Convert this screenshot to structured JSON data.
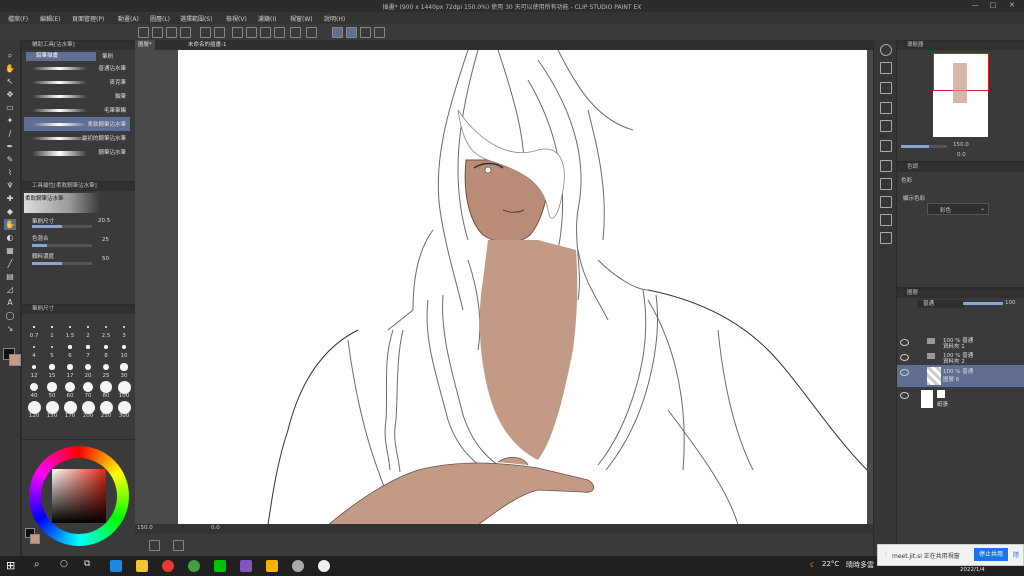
{
  "window": {
    "title": "插畫* (900 x 1440px 72dpi 150.0%)  使用 30 天可以使用所有功能 - CLIP STUDIO PAINT EX",
    "minimize": "—",
    "maximize": "□",
    "close": "✕"
  },
  "menu": [
    "檔案(F)",
    "編輯(E)",
    "頁面管理(P)",
    "動畫(A)",
    "圖層(L)",
    "選擇範圍(S)",
    "檢視(V)",
    "濾鏡(I)",
    "視窗(W)",
    "說明(H)"
  ],
  "doc_tabs": [
    "圖層*",
    "未命名的插畫-1"
  ],
  "left": {
    "subtool_header": "輔助工具[沾水筆]",
    "subtool_tabs": [
      "鉛筆描畫",
      "筆刷"
    ],
    "brushes": [
      {
        "label": "普通沾水筆",
        "selected": false
      },
      {
        "label": "麥克筆",
        "selected": false
      },
      {
        "label": "軸筆",
        "selected": false
      },
      {
        "label": "毛筆筆觸",
        "selected": false
      },
      {
        "label": "柔軟鋼筆沾水筆",
        "selected": true
      },
      {
        "label": "最初的鋼筆沾水筆",
        "selected": false
      },
      {
        "label": "鋼筆沾水筆",
        "selected": false
      }
    ],
    "tool_prop_header": "工具屬性[柔軟鋼筆沾水筆]",
    "tool_prop_preview": "柔軟鋼筆沾水筆",
    "props": [
      {
        "label": "筆刷尺寸",
        "value": "20.5"
      },
      {
        "label": "色混合",
        "value": "25"
      },
      {
        "label": "顏料濃度",
        "value": "50"
      }
    ],
    "brush_size_header": "筆刷尺寸",
    "sizes": [
      "0.7",
      "1",
      "1.5",
      "2",
      "2.5",
      "3",
      "4",
      "5",
      "6",
      "7",
      "8",
      "10",
      "12",
      "15",
      "17",
      "20",
      "25",
      "30",
      "40",
      "50",
      "60",
      "70",
      "80",
      "100",
      "120",
      "150",
      "170",
      "200",
      "250",
      "300"
    ]
  },
  "canvas_status": {
    "zoom": "150.0",
    "pos": "0.0"
  },
  "right": {
    "navigator_header": "導航器",
    "nav_zoom": "150.0",
    "nav_rotate": "0.0",
    "tool_header": "色調",
    "tool_section": "色彩",
    "expression_label": "顯示色彩",
    "expression_value": "彩色",
    "layer_header": "圖層",
    "blend_mode": "普通",
    "opacity": "100",
    "layers": [
      {
        "name": "100 % 普通",
        "sub": "資料夾 1",
        "type": "folder"
      },
      {
        "name": "100 % 普通",
        "sub": "資料夾 2",
        "type": "folder"
      },
      {
        "name": "100 % 普通",
        "sub": "圖層 6",
        "type": "layer",
        "selected": true
      },
      {
        "name": "",
        "sub": "紙張",
        "type": "paper"
      }
    ]
  },
  "taskbar": {
    "weather": "22°C",
    "weather_desc": "晴時多雲",
    "date": "2022/1/4",
    "notif_text": "meet.jit.si 正在共用視窗",
    "notif_button": "停止共用",
    "notif_hide": "隱"
  },
  "colors": {
    "accent": "#5f6e92",
    "canvas_bg": "#ffffff",
    "skin": "#b98c77"
  }
}
